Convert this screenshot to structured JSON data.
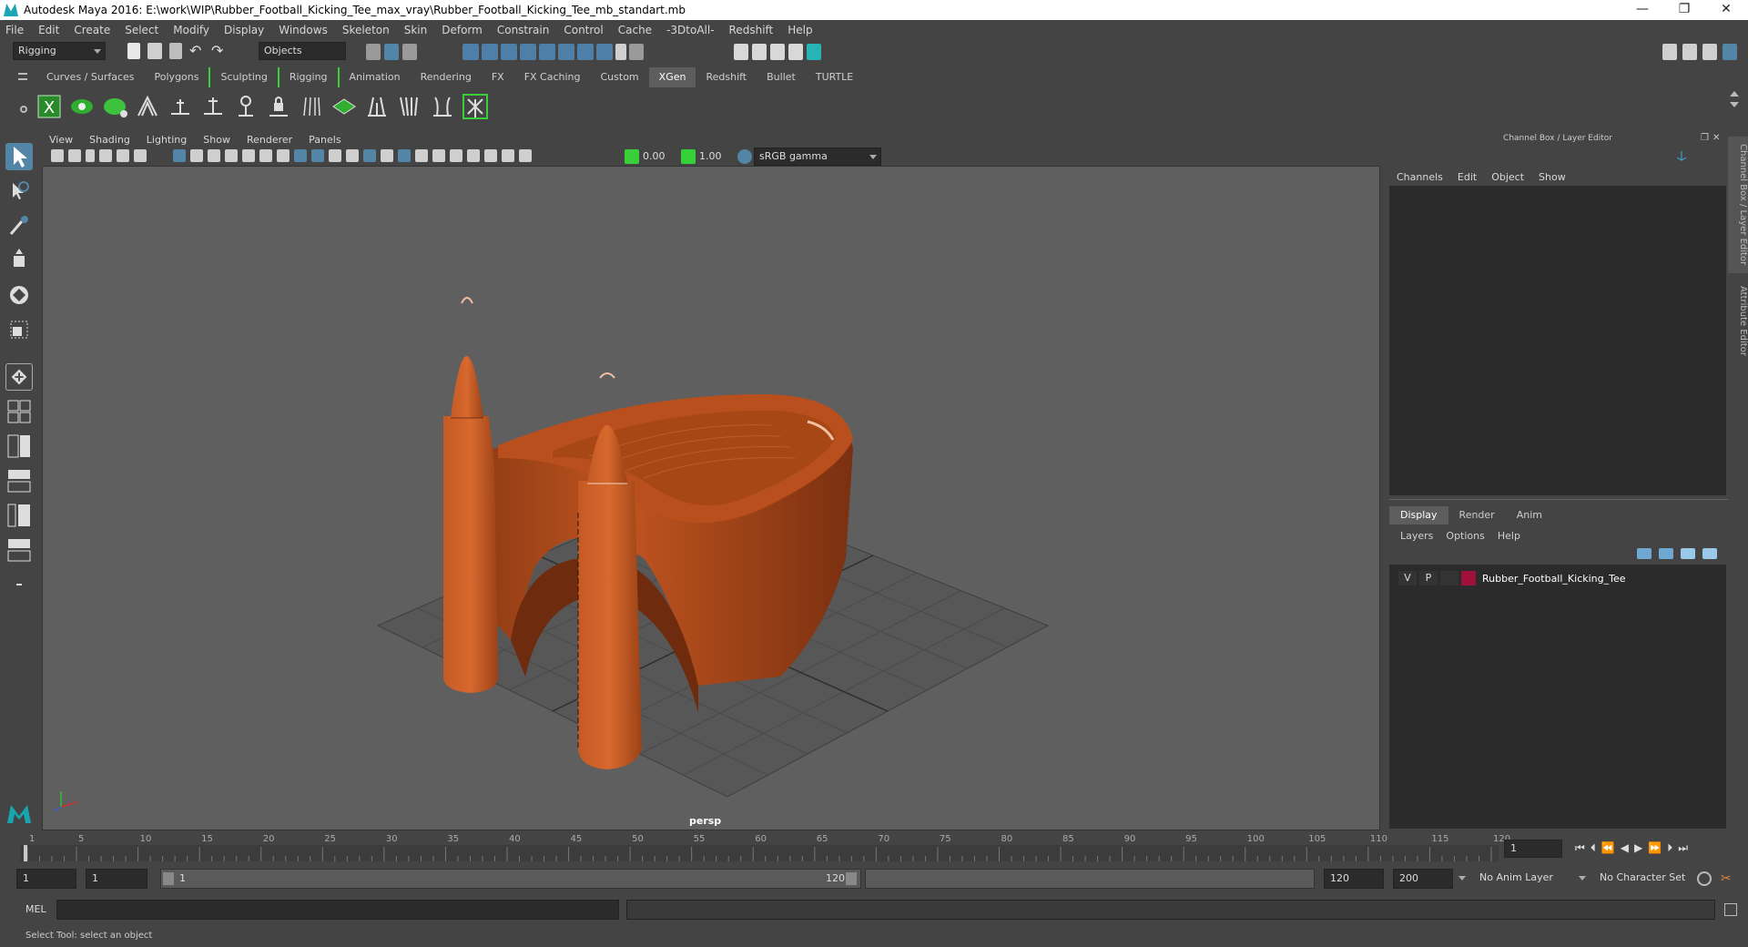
{
  "window": {
    "title": "Autodesk Maya 2016: E:\\work\\WIP\\Rubber_Football_Kicking_Tee_max_vray\\Rubber_Football_Kicking_Tee_mb_standart.mb",
    "controls": [
      "—",
      "❐",
      "✕"
    ]
  },
  "menubar": [
    "File",
    "Edit",
    "Create",
    "Select",
    "Modify",
    "Display",
    "Windows",
    "Skeleton",
    "Skin",
    "Deform",
    "Constrain",
    "Control",
    "Cache",
    "-3DtoAll-",
    "Redshift",
    "Help"
  ],
  "statusline": {
    "menuset": "Rigging",
    "selection_mode": "Objects"
  },
  "shelf": {
    "tabs": [
      "Curves / Surfaces",
      "Polygons",
      "Sculpting",
      "Rigging",
      "Animation",
      "Rendering",
      "FX",
      "FX Caching",
      "Custom",
      "XGen",
      "Redshift",
      "Bullet",
      "TURTLE"
    ],
    "active_tab": "XGen",
    "icons": [
      "xgen-icon",
      "xgen-preview-icon",
      "xgen-create-icon",
      "xgen-guides-icon",
      "add-guide-icon",
      "insert-guide-icon",
      "guide-pivot-icon",
      "lock-guide-icon",
      "guide-rebuild-icon",
      "guide-sculpt-icon",
      "guide-shape-icon",
      "guide-comb-icon",
      "guide-clump-icon",
      "guide-manip-icon"
    ]
  },
  "viewport": {
    "menu": [
      "View",
      "Shading",
      "Lighting",
      "Show",
      "Renderer",
      "Panels"
    ],
    "exposure": "0.00",
    "gamma": "1.00",
    "color_space": "sRGB gamma",
    "camera": "persp"
  },
  "right_panel": {
    "header": "Channel Box / Layer Editor",
    "channel_menu": [
      "Channels",
      "Edit",
      "Object",
      "Show"
    ],
    "layer_tabs": [
      "Display",
      "Render",
      "Anim"
    ],
    "layer_active_tab": "Display",
    "layer_menu": [
      "Layers",
      "Options",
      "Help"
    ],
    "layer": {
      "visible": "V",
      "playback": "P",
      "name": "Rubber_Football_Kicking_Tee",
      "color": "#a0103a"
    },
    "side_tabs": [
      "Channel Box / Layer Editor",
      "Attribute Editor"
    ]
  },
  "timeline": {
    "ticks": [
      "1",
      "5",
      "10",
      "15",
      "20",
      "25",
      "30",
      "35",
      "40",
      "45",
      "50",
      "55",
      "60",
      "65",
      "70",
      "75",
      "80",
      "85",
      "90",
      "95",
      "100",
      "105",
      "110",
      "115",
      "120"
    ],
    "current_frame": "1"
  },
  "range": {
    "start": "1",
    "playback_start": "1",
    "slider_start": "1",
    "slider_end": "120",
    "playback_end": "120",
    "end": "200",
    "anim_layer": "No Anim Layer",
    "character_set": "No Character Set"
  },
  "command": {
    "label": "MEL"
  },
  "help_line": "Select Tool: select an object",
  "colors": {
    "accent": "#5285a6",
    "object": "#c0541f",
    "grid": "#4a4a4a"
  }
}
